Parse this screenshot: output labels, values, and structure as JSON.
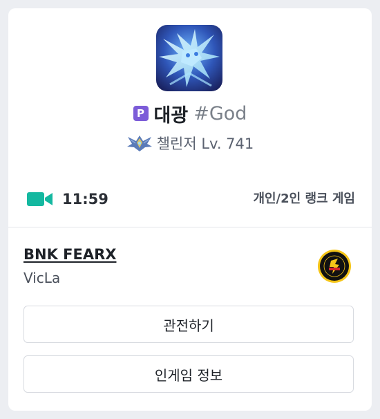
{
  "profile": {
    "avatar_icon": "ice-phoenix-champion-icon",
    "platform_badge": "P",
    "platform_badge_color": "#7c5cd8",
    "name": "대광",
    "tag": "#God",
    "rank_emblem_icon": "challenger-emblem-icon",
    "rank_text": "챌린저 Lv. 741"
  },
  "status": {
    "icon": "video-camera-icon",
    "icon_color": "#14b8a0",
    "elapsed_time": "11:59",
    "queue_type": "개인/2인 랭크 게임"
  },
  "pro": {
    "team_name": "BNK FEARX",
    "player_name": "VicLa",
    "team_logo_icon": "bnk-fearx-logo-icon"
  },
  "actions": {
    "spectate_label": "관전하기",
    "ingame_info_label": "인게임 정보"
  }
}
